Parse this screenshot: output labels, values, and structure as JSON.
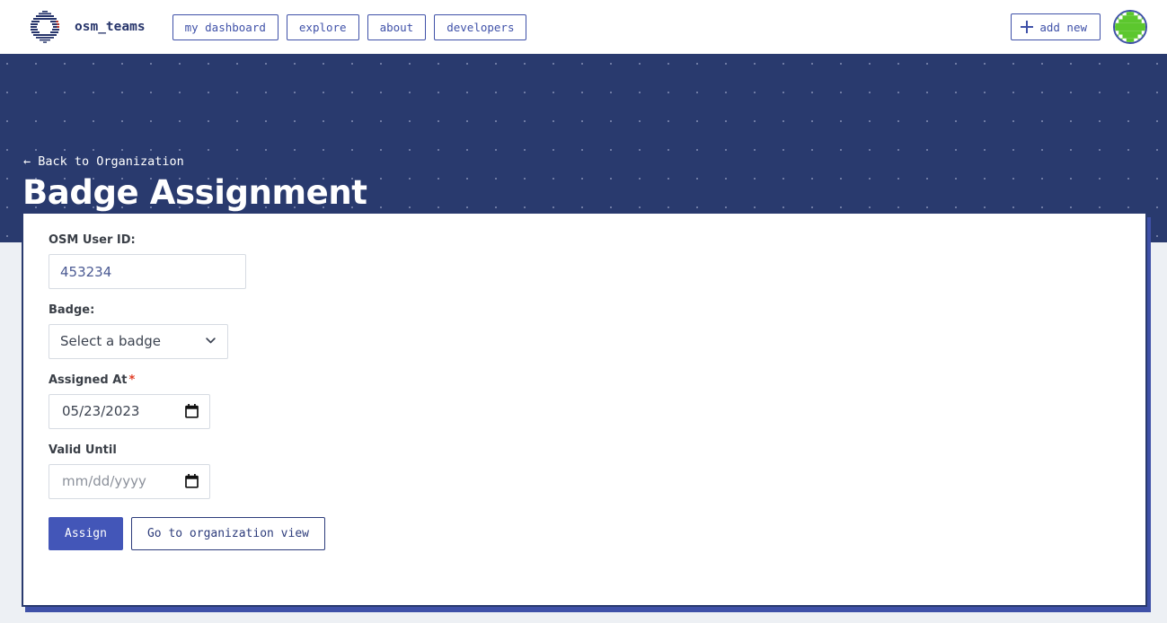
{
  "navbar": {
    "logo_icon": "osm-teams-logo-icon",
    "brand": "osm_teams",
    "links": [
      {
        "label": "my dashboard",
        "name": "nav-my-dashboard"
      },
      {
        "label": "explore",
        "name": "nav-explore"
      },
      {
        "label": "about",
        "name": "nav-about"
      },
      {
        "label": "developers",
        "name": "nav-developers"
      }
    ],
    "add_new": {
      "label": "add new",
      "icon": "plus-icon"
    },
    "avatar_icon": "user-avatar-identicon"
  },
  "banner": {
    "back_link": "← Back to Organization",
    "title": "Badge Assignment",
    "background_color": "#293a6e",
    "dot_color": "#6e7aa3"
  },
  "form": {
    "osm_user_id": {
      "label": "OSM User ID:",
      "value": "453234",
      "placeholder": "OSM User ID"
    },
    "badge": {
      "label": "Badge:",
      "selected": "Select a badge",
      "options": [
        "Select a badge"
      ],
      "chevron_icon": "chevron-down-icon"
    },
    "assigned_at": {
      "label": "Assigned At",
      "required_marker": "*",
      "value": "05/23/2023",
      "calendar_icon": "calendar-icon"
    },
    "valid_until": {
      "label": "Valid Until",
      "value": "",
      "placeholder": "mm/dd/yyyy",
      "calendar_icon": "calendar-icon"
    },
    "buttons": {
      "submit": "Assign",
      "secondary": "Go to organization view"
    }
  },
  "colors": {
    "brand_navy": "#293a6e",
    "accent_blue": "#4356b8",
    "link_blue": "#3f51a8",
    "required_red": "#e03b24",
    "page_background": "#edf0f4",
    "avatar_green": "#5cc72e"
  }
}
